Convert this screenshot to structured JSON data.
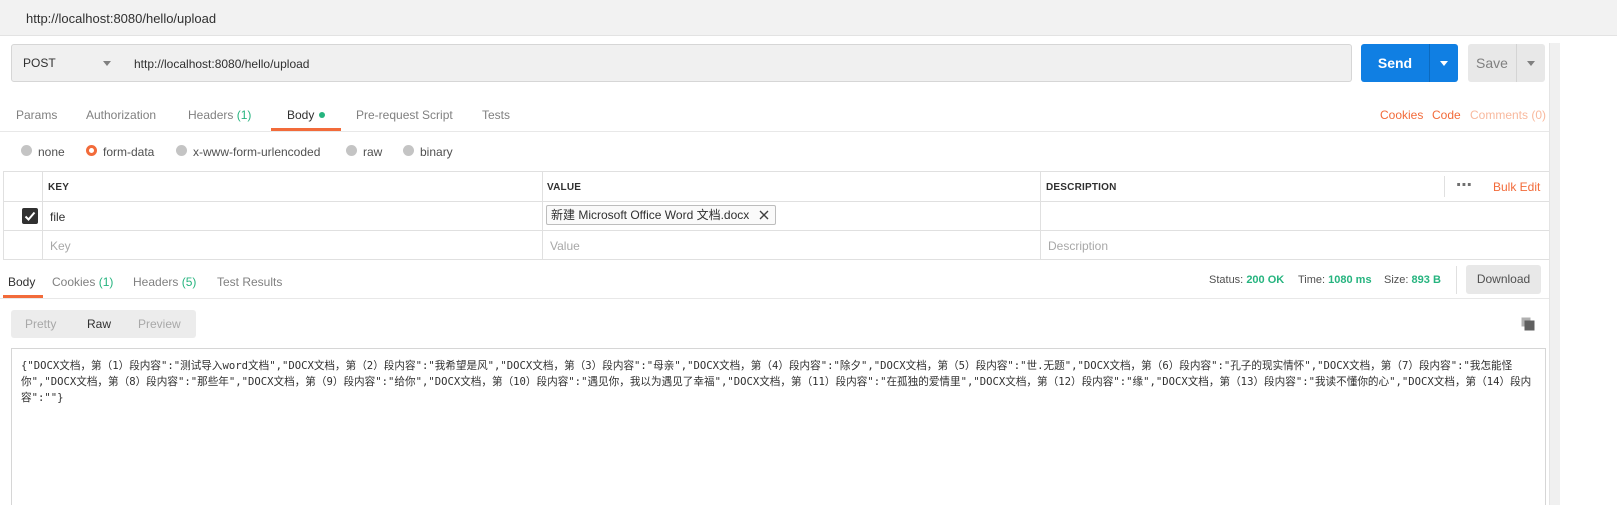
{
  "tab": {
    "title": "http://localhost:8080/hello/upload"
  },
  "request": {
    "method": "POST",
    "url": "http://localhost:8080/hello/upload",
    "send_label": "Send",
    "save_label": "Save"
  },
  "request_tabs": [
    {
      "label": "Params",
      "count": ""
    },
    {
      "label": "Authorization",
      "count": ""
    },
    {
      "label": "Headers",
      "count": "(1)"
    },
    {
      "label": "Body",
      "count": ""
    },
    {
      "label": "Pre-request Script",
      "count": ""
    },
    {
      "label": "Tests",
      "count": ""
    }
  ],
  "right_links": {
    "cookies": "Cookies",
    "code": "Code",
    "comments": "Comments (0)"
  },
  "body_types": [
    {
      "label": "none",
      "selected": false
    },
    {
      "label": "form-data",
      "selected": true
    },
    {
      "label": "x-www-form-urlencoded",
      "selected": false
    },
    {
      "label": "raw",
      "selected": false
    },
    {
      "label": "binary",
      "selected": false
    }
  ],
  "form_table": {
    "headers": {
      "key": "KEY",
      "value": "VALUE",
      "description": "DESCRIPTION"
    },
    "more_icon": "⋯",
    "bulk_edit": "Bulk Edit",
    "rows": [
      {
        "checked": true,
        "key": "file",
        "value": "新建 Microsoft Office Word 文档.docx",
        "description": ""
      }
    ],
    "placeholders": {
      "key": "Key",
      "value": "Value",
      "description": "Description"
    }
  },
  "response_tabs": [
    {
      "label": "Body",
      "count": ""
    },
    {
      "label": "Cookies",
      "count": "(1)"
    },
    {
      "label": "Headers",
      "count": "(5)"
    },
    {
      "label": "Test Results",
      "count": ""
    }
  ],
  "response_status": {
    "status_label": "Status:",
    "status_value": "200 OK",
    "time_label": "Time:",
    "time_value": "1080 ms",
    "size_label": "Size:",
    "size_value": "893 B",
    "download_label": "Download"
  },
  "view_modes": {
    "pretty": "Pretty",
    "raw": "Raw",
    "preview": "Preview",
    "selected": "Raw"
  },
  "response_body": "{\"DOCX文档，第（1）段内容\":\"测试导入word文档\",\"DOCX文档，第（2）段内容\":\"我希望是风\",\"DOCX文档，第（3）段内容\":\"母亲\",\"DOCX文档，第（4）段内容\":\"除夕\",\"DOCX文档，第（5）段内容\":\"世.无题\",\"DOCX文档，第（6）段内容\":\"孔子的现实情怀\",\"DOCX文档，第（7）段内容\":\"我怎能怪你\",\"DOCX文档，第（8）段内容\":\"那些年\",\"DOCX文档，第（9）段内容\":\"给你\",\"DOCX文档，第（10）段内容\":\"遇见你，我以为遇见了幸福\",\"DOCX文档，第（11）段内容\":\"在孤独的爱情里\",\"DOCX文档，第（12）段内容\":\"缘\",\"DOCX文档，第（13）段内容\":\"我读不懂你的心\",\"DOCX文档，第（14）段内容\":\"\"}",
  "colors": {
    "accent": "#f26b3a",
    "send": "#107fe3",
    "success": "#26b47f"
  }
}
